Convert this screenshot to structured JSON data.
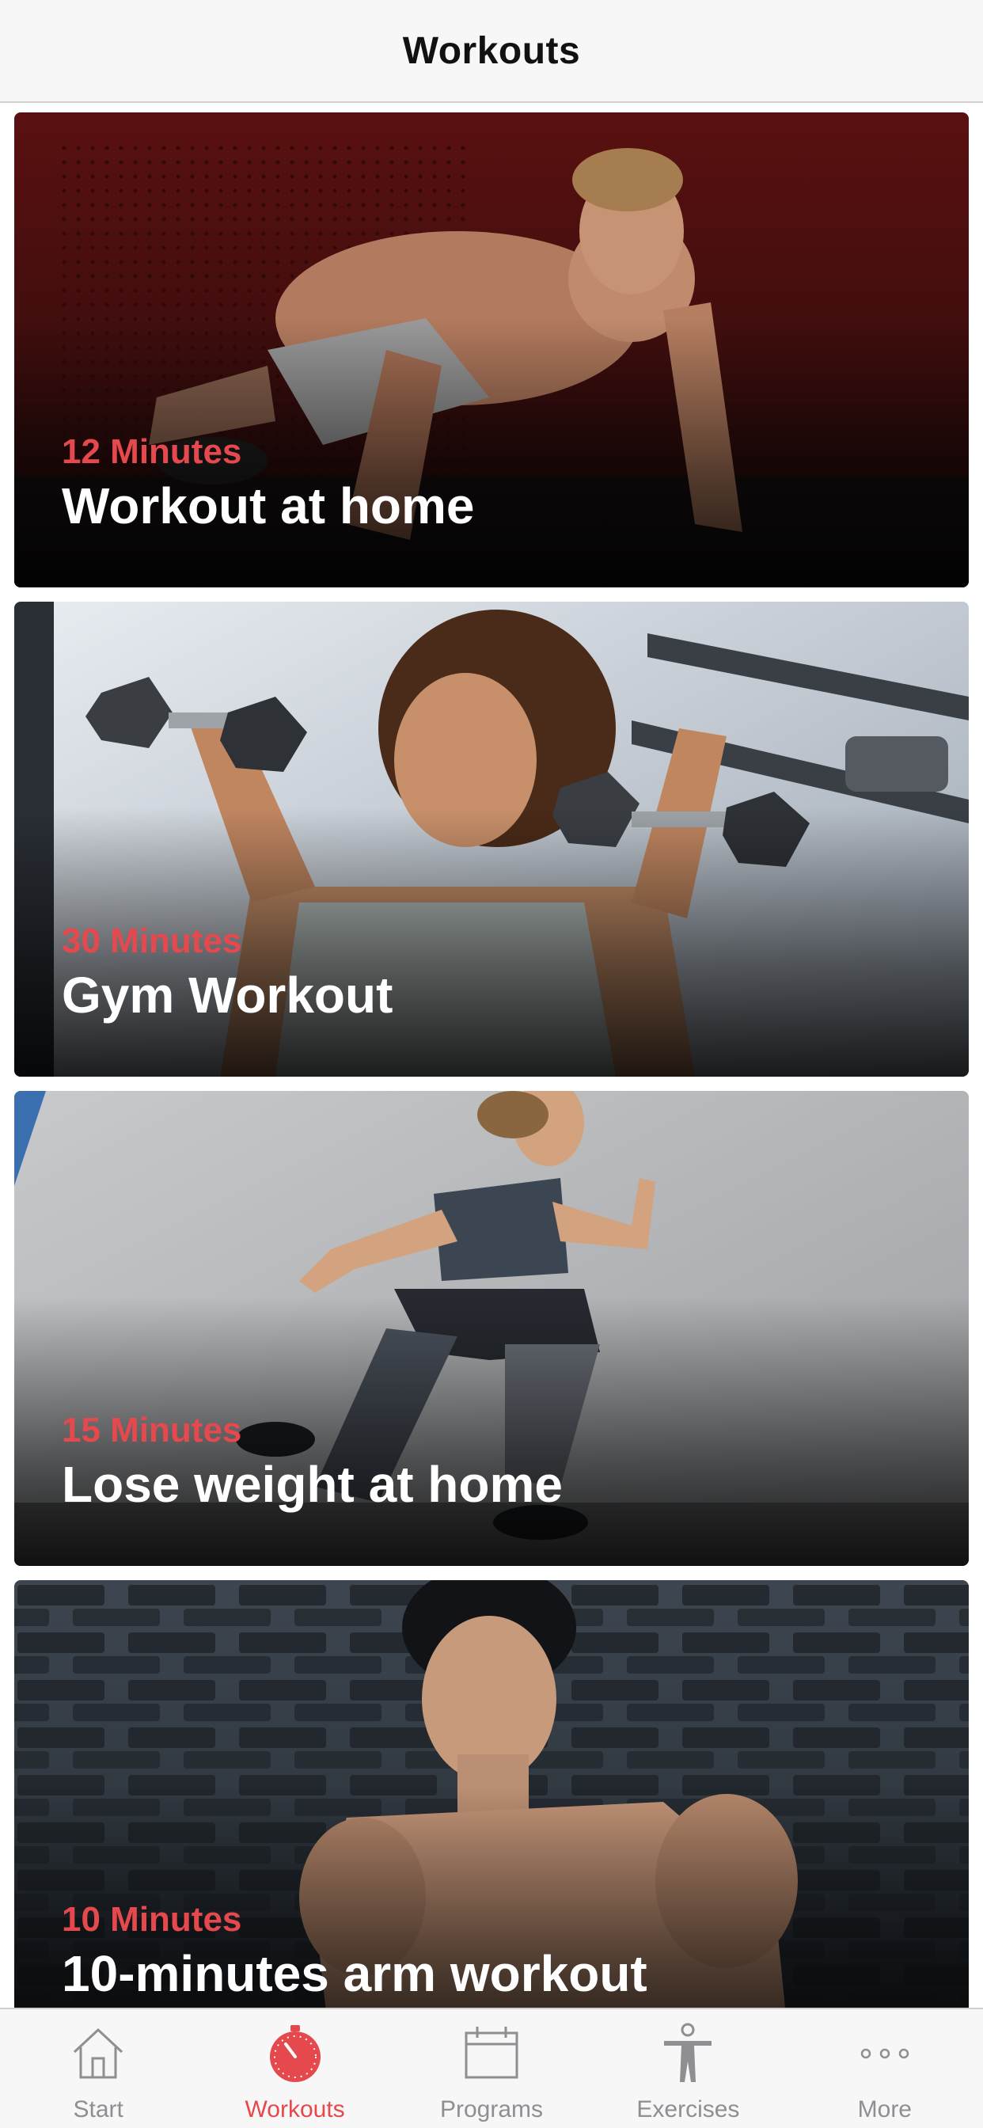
{
  "nav": {
    "title": "Workouts"
  },
  "workouts": [
    {
      "duration": "12 Minutes",
      "title": "Workout at home"
    },
    {
      "duration": "30 Minutes",
      "title": "Gym Workout"
    },
    {
      "duration": "15 Minutes",
      "title": "Lose weight at home"
    },
    {
      "duration": "10 Minutes",
      "title": "10-minutes arm workout"
    }
  ],
  "tabs": [
    {
      "label": "Start",
      "icon": "home-icon",
      "active": false
    },
    {
      "label": "Workouts",
      "icon": "stopwatch-icon",
      "active": true
    },
    {
      "label": "Programs",
      "icon": "calendar-icon",
      "active": false
    },
    {
      "label": "Exercises",
      "icon": "person-icon",
      "active": false
    },
    {
      "label": "More",
      "icon": "more-dots-icon",
      "active": false
    }
  ],
  "colors": {
    "accent": "#e5484d",
    "inactive": "#8e8e93",
    "bar_background": "#f7f7f7"
  }
}
